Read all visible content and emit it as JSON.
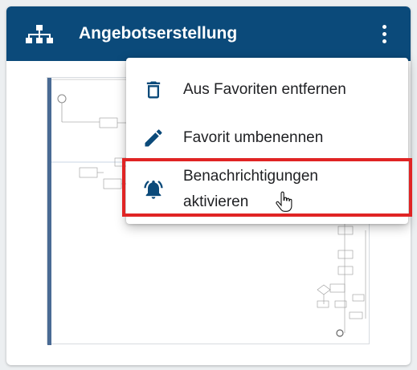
{
  "header": {
    "title": "Angebotserstellung",
    "icon": "sitemap-icon",
    "menu_icon": "more-vert-icon",
    "background": "#0b4a7a"
  },
  "menu": {
    "items": [
      {
        "label": "Aus Favoriten entfernen",
        "icon": "trash-icon"
      },
      {
        "label": "Favorit umbenennen",
        "icon": "pencil-icon"
      },
      {
        "label": "Benachrichtigungen aktivieren",
        "icon": "bell-ringing-icon"
      }
    ],
    "highlight_color": "#e02424"
  },
  "diagram": {
    "preview": "process-diagram-thumbnail"
  }
}
